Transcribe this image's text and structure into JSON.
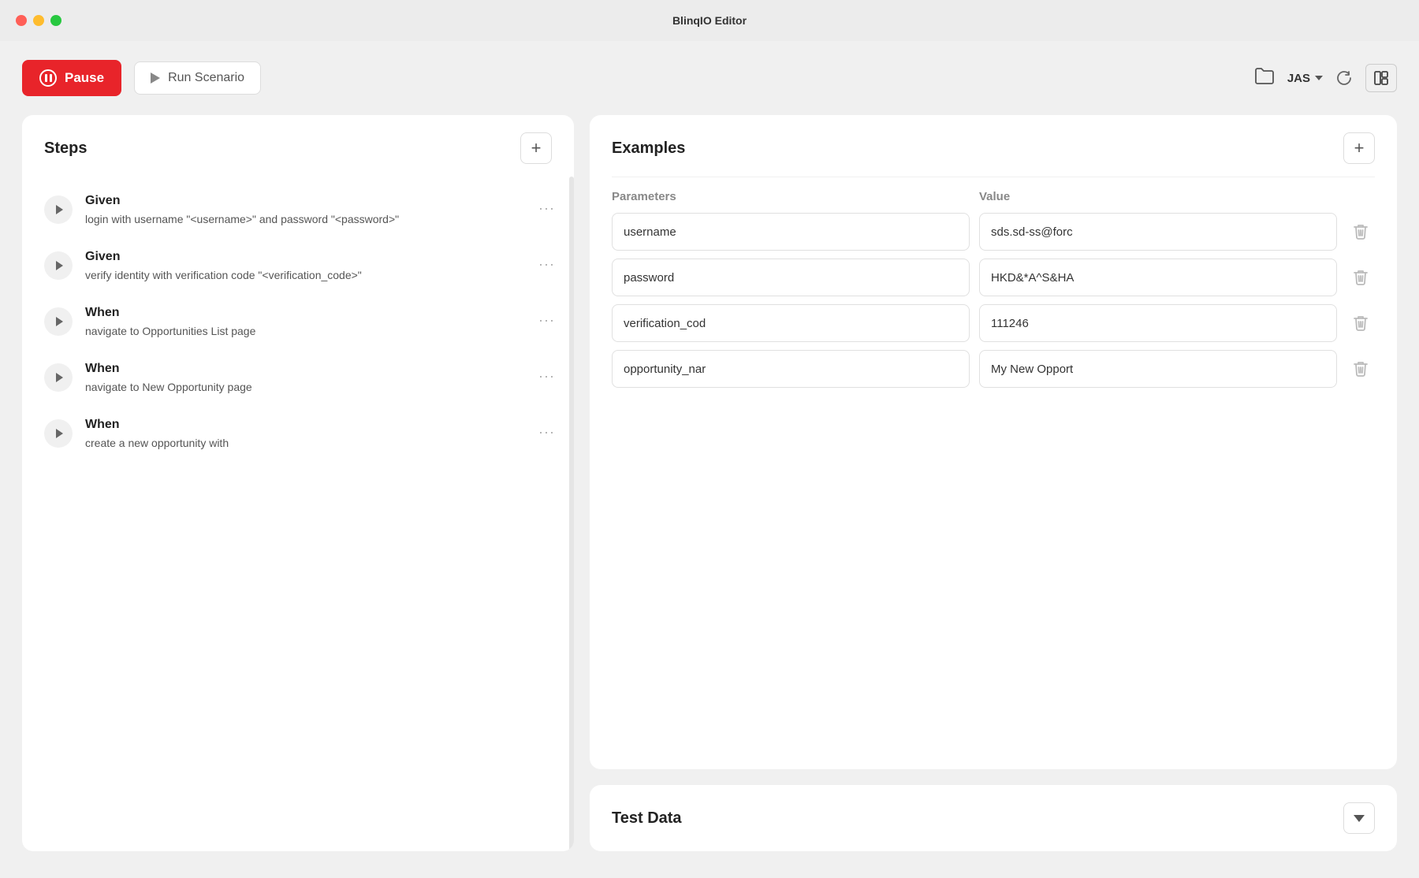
{
  "titleBar": {
    "title": "BlinqIO Editor"
  },
  "toolbar": {
    "pauseLabel": "Pause",
    "runLabel": "Run Scenario",
    "userLabel": "JAS",
    "refreshTooltip": "Refresh",
    "layoutTooltip": "Toggle Layout"
  },
  "stepsPanel": {
    "title": "Steps",
    "addButtonLabel": "+",
    "steps": [
      {
        "keyword": "Given",
        "description": "login with username \"<username>\" and password \"<password>\""
      },
      {
        "keyword": "Given",
        "description": "verify identity with verification code \"<verification_code>\""
      },
      {
        "keyword": "When",
        "description": "navigate to Opportunities List page"
      },
      {
        "keyword": "When",
        "description": "navigate to New Opportunity page"
      },
      {
        "keyword": "When",
        "description": "create a new opportunity with"
      }
    ]
  },
  "examplesPanel": {
    "title": "Examples",
    "addButtonLabel": "+",
    "headers": {
      "parameters": "Parameters",
      "value": "Value"
    },
    "rows": [
      {
        "param": "username",
        "value": "sds.sd-ss@forc"
      },
      {
        "param": "password",
        "value": "HKD&*A^S&HA"
      },
      {
        "param": "verification_cod",
        "value": "111246"
      },
      {
        "param": "opportunity_nar",
        "value": "My New Opport"
      }
    ]
  },
  "testDataPanel": {
    "title": "Test Data"
  },
  "colors": {
    "pauseRed": "#e8242a",
    "accent": "#e8242a"
  }
}
